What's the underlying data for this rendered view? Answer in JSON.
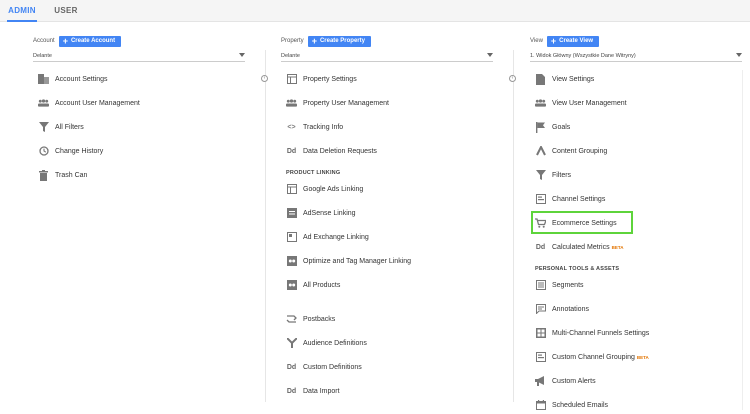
{
  "tabs": {
    "admin": "ADMIN",
    "user": "USER"
  },
  "account": {
    "label": "Account",
    "create_label": "Create Account",
    "selected": "Delante",
    "items": [
      "Account Settings",
      "Account User Management",
      "All Filters",
      "Change History",
      "Trash Can"
    ]
  },
  "property": {
    "label": "Property",
    "create_label": "Create Property",
    "selected": "Delante",
    "items": [
      "Property Settings",
      "Property User Management",
      "Tracking Info",
      "Data Deletion Requests"
    ],
    "section_product_linking": "PRODUCT LINKING",
    "linking": [
      "Google Ads Linking",
      "AdSense Linking",
      "Ad Exchange Linking",
      "Optimize and Tag Manager Linking",
      "All Products"
    ],
    "more": [
      "Postbacks",
      "Audience Definitions",
      "Custom Definitions",
      "Data Import"
    ]
  },
  "view": {
    "label": "View",
    "create_label": "Create View",
    "selected": "1. Widok Główny (Wszystkie Dane Witryny)",
    "items": [
      "View Settings",
      "View User Management",
      "Goals",
      "Content Grouping",
      "Filters",
      "Channel Settings",
      "Ecommerce Settings",
      "Calculated Metrics"
    ],
    "section_personal": "PERSONAL TOOLS & ASSETS",
    "personal": [
      "Segments",
      "Annotations",
      "Multi-Channel Funnels Settings",
      "Custom Channel Grouping",
      "Custom Alerts",
      "Scheduled Emails"
    ],
    "beta": "BETA"
  },
  "icons": {
    "dd": "Dd",
    "code": "<>",
    "plus": "+",
    "collapse": "‹"
  },
  "colors": {
    "accent": "#4285f4",
    "highlight": "#5ed43b",
    "beta": "#e37400",
    "icon": "#777777"
  }
}
